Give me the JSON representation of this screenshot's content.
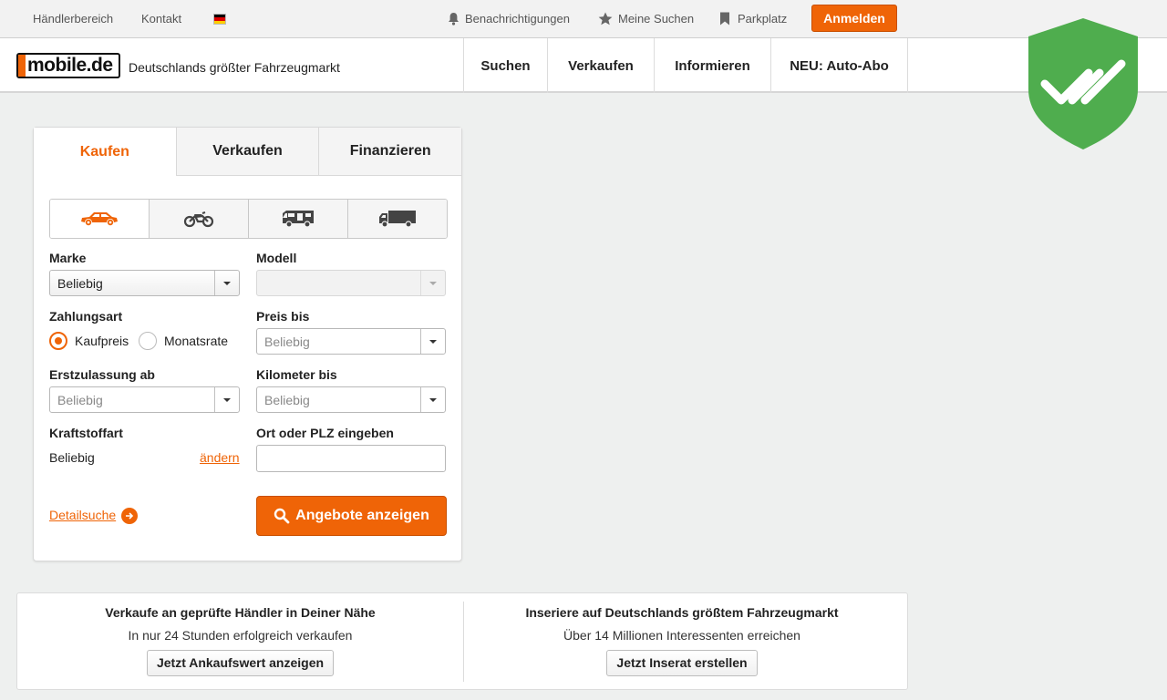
{
  "topbar": {
    "dealer_area": "Händlerbereich",
    "contact": "Kontakt",
    "notifications": "Benachrichtigungen",
    "my_searches": "Meine Suchen",
    "parking": "Parkplatz",
    "login": "Anmelden",
    "language_flag": "de-flag-icon"
  },
  "header": {
    "logo_text": "mobile.de",
    "tagline": "Deutschlands größter Fahrzeugmarkt",
    "nav": [
      "Suchen",
      "Verkaufen",
      "Informieren",
      "NEU: Auto-Abo"
    ]
  },
  "colors": {
    "accent": "#ef6407",
    "shield_green": "#4fad4e"
  },
  "search": {
    "tabs": [
      "Kaufen",
      "Verkaufen",
      "Finanzieren"
    ],
    "active_tab": "Kaufen",
    "vehicle_types": [
      "car-icon",
      "motorbike-icon",
      "camper-icon",
      "truck-icon"
    ],
    "make_label": "Marke",
    "make_value": "Beliebig",
    "model_label": "Modell",
    "model_value": "",
    "payment_label": "Zahlungsart",
    "payment_options": [
      "Kaufpreis",
      "Monatsrate"
    ],
    "payment_selected": "Kaufpreis",
    "price_label": "Preis bis",
    "price_placeholder": "Beliebig",
    "first_reg_label": "Erstzulassung ab",
    "first_reg_placeholder": "Beliebig",
    "km_label": "Kilometer bis",
    "km_placeholder": "Beliebig",
    "fuel_label": "Kraftstoffart",
    "fuel_value": "Beliebig",
    "fuel_change": "ändern",
    "location_label": "Ort oder PLZ eingeben",
    "location_value": "",
    "detail_search": "Detailsuche",
    "submit": "Angebote anzeigen"
  },
  "promo": {
    "left_title": "Verkaufe an geprüfte Händler in Deiner Nähe",
    "left_sub": "In nur 24 Stunden erfolgreich verkaufen",
    "left_button": "Jetzt Ankaufswert anzeigen",
    "right_title": "Inseriere auf Deutschlands größtem Fahrzeugmarkt",
    "right_sub": "Über 14 Millionen Interessenten erreichen",
    "right_button": "Jetzt Inserat erstellen"
  }
}
